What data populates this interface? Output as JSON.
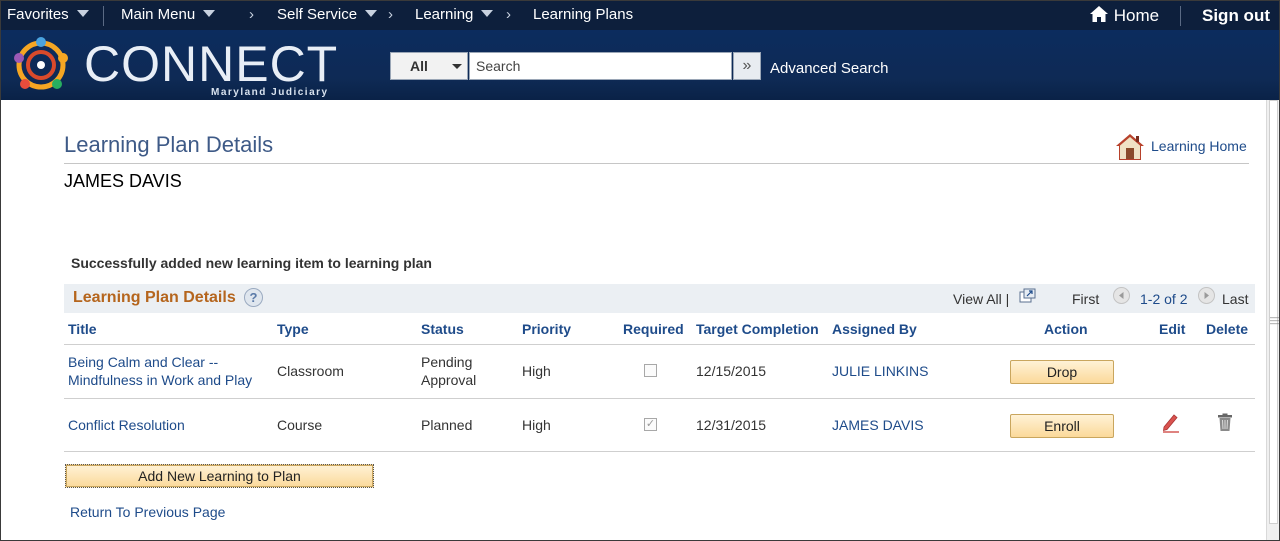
{
  "topnav": {
    "favorites": "Favorites",
    "main_menu": "Main Menu",
    "breadcrumb": [
      "Self Service",
      "Learning",
      "Learning Plans"
    ],
    "home": "Home",
    "sign_out": "Sign out"
  },
  "brand": {
    "name": "CONNECT",
    "subtitle": "Maryland Judiciary"
  },
  "search": {
    "scope": "All",
    "placeholder": "Search",
    "advanced": "Advanced Search"
  },
  "page": {
    "title": "Learning Plan Details",
    "learning_home": "Learning Home",
    "person": "JAMES DAVIS",
    "message": "Successfully added new learning item to learning plan"
  },
  "grid": {
    "title": "Learning Plan Details",
    "help": "?",
    "view_all": "View All |",
    "first": "First",
    "range": "1-2 of 2",
    "last": "Last",
    "columns": [
      "Title",
      "Type",
      "Status",
      "Priority",
      "Required",
      "Target Completion",
      "Assigned By",
      "Action",
      "Edit",
      "Delete"
    ],
    "rows": [
      {
        "title_line1": "Being Calm and Clear --",
        "title_line2": "Mindfulness in Work and Play",
        "type": "Classroom",
        "status_line1": "Pending",
        "status_line2": "Approval",
        "priority": "High",
        "required": false,
        "target_completion": "12/15/2015",
        "assigned_by": "JULIE LINKINS",
        "action": "Drop"
      },
      {
        "title_line1": "Conflict Resolution",
        "type": "Course",
        "status_line1": "Planned",
        "priority": "High",
        "required": true,
        "target_completion": "12/31/2015",
        "assigned_by": "JAMES DAVIS",
        "action": "Enroll"
      }
    ]
  },
  "buttons": {
    "add_new": "Add New Learning to Plan",
    "return": "Return To Previous Page"
  },
  "colors": {
    "nav_bg": "#0d1f3c",
    "banner_bg": "#0e2a55",
    "link": "#1e4b8a",
    "grid_title": "#b5651d",
    "button_bg": "#fbd99a"
  }
}
